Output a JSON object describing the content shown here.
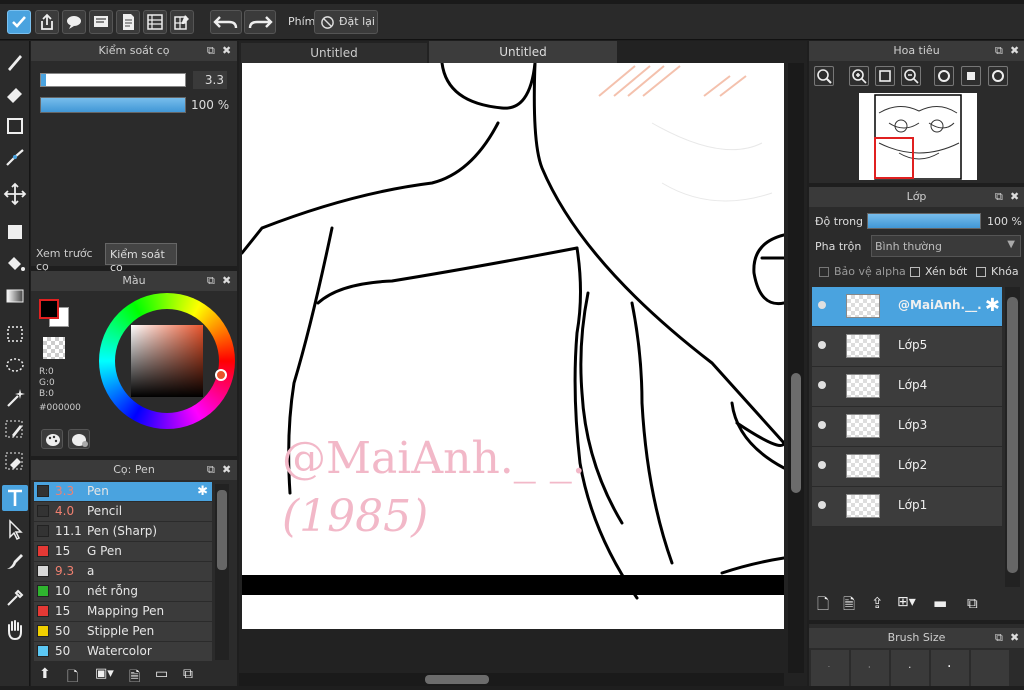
{
  "toolbar": {
    "shortcut_label": "Phím",
    "reset_label": "Đặt lại"
  },
  "brush_control": {
    "title": "Kiểm soát cọ",
    "size_value": "3.3",
    "opacity_value": "100 %",
    "size_fraction": 0.03,
    "opacity_fraction": 1.0,
    "tabs": [
      "Xem trước cọ",
      "Kiểm soát cọ"
    ]
  },
  "color_panel": {
    "title": "Màu",
    "r": "R:0",
    "g": "G:0",
    "b": "B:0",
    "hex": "#000000",
    "fg_color": "#000000",
    "bg_color": "#ffffff"
  },
  "brush_list": {
    "title": "Cọ: Pen",
    "items": [
      {
        "size": "3.3",
        "name": "Pen",
        "color": "#333333",
        "selected": true
      },
      {
        "size": "4.0",
        "name": "Pencil",
        "color": "#333333"
      },
      {
        "size": "11.1",
        "name": "Pen (Sharp)",
        "color": "#333333"
      },
      {
        "size": "15",
        "name": "G Pen",
        "color": "#e53935"
      },
      {
        "size": "9.3",
        "name": "a",
        "color": "#d8d8d8"
      },
      {
        "size": "10",
        "name": "nét rỗng",
        "color": "#2fb52f"
      },
      {
        "size": "15",
        "name": "Mapping Pen",
        "color": "#e53935"
      },
      {
        "size": "50",
        "name": "Stipple Pen",
        "color": "#f0d000"
      },
      {
        "size": "50",
        "name": "Watercolor",
        "color": "#5bc8f5"
      }
    ]
  },
  "canvas": {
    "tabs": [
      "Untitled",
      "Untitled"
    ],
    "watermark_line1": "@MaiAnh._ _.",
    "watermark_line2": "(1985)"
  },
  "navigator": {
    "title": "Hoa tiêu"
  },
  "layers": {
    "title": "Lớp",
    "opacity_label": "Độ trong",
    "opacity_value": "100 %",
    "opacity_fraction": 1.0,
    "blend_label": "Pha trộn",
    "blend_value": "Bình thường",
    "protect_alpha": "Bảo vệ alpha",
    "clipping": "Xén bớt",
    "lock": "Khóa",
    "items": [
      {
        "name": "@MaiAnh.__.",
        "selected": true
      },
      {
        "name": "Lớp5"
      },
      {
        "name": "Lớp4"
      },
      {
        "name": "Lớp3"
      },
      {
        "name": "Lớp2"
      },
      {
        "name": "Lớp1"
      }
    ]
  },
  "brush_size_panel": {
    "title": "Brush Size"
  },
  "colors": {
    "accent": "#4aa3df",
    "panel_bg": "#2b2b2b",
    "watermark": "#f2b8c8"
  }
}
